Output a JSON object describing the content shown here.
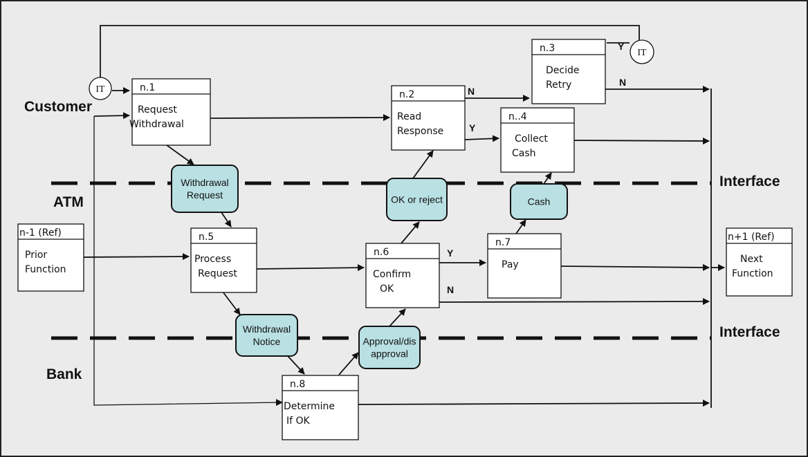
{
  "colors": {
    "background": "#ebebeb",
    "message": "#b9e0e3",
    "line": "#111111",
    "box": "#ffffff"
  },
  "lanes": [
    {
      "id": "customer",
      "label": "Customer"
    },
    {
      "id": "atm",
      "label": "ATM"
    },
    {
      "id": "bank",
      "label": "Bank"
    }
  ],
  "interfaces": [
    {
      "label": "Interface"
    },
    {
      "label": "Interface"
    }
  ],
  "connectors": [
    {
      "label": "IT"
    },
    {
      "label": "IT"
    }
  ],
  "nodes": [
    {
      "id": "n1",
      "ref": "n.1",
      "lines": [
        "Request",
        "Withdrawal"
      ]
    },
    {
      "id": "n2",
      "ref": "n.2",
      "lines": [
        "Read",
        "Response"
      ]
    },
    {
      "id": "n3",
      "ref": "n.3",
      "lines": [
        "Decide",
        "Retry"
      ]
    },
    {
      "id": "n4",
      "ref": "n..4",
      "lines": [
        "Collect",
        "Cash"
      ]
    },
    {
      "id": "n5",
      "ref": "n.5",
      "lines": [
        "Process",
        "Request"
      ]
    },
    {
      "id": "n6",
      "ref": "n.6",
      "lines": [
        "Confirm",
        "OK"
      ]
    },
    {
      "id": "n7",
      "ref": "n.7",
      "lines": [
        "Pay"
      ]
    },
    {
      "id": "n8",
      "ref": "n.8",
      "lines": [
        "Determine",
        "If  OK"
      ]
    },
    {
      "id": "prev",
      "ref": "n-1 (Ref)",
      "lines": [
        "Prior",
        "Function"
      ]
    },
    {
      "id": "next",
      "ref": "n+1 (Ref)",
      "lines": [
        "Next",
        "Function"
      ]
    }
  ],
  "messages": [
    {
      "id": "m1",
      "lines": [
        "Withdrawal",
        "Request"
      ]
    },
    {
      "id": "m2",
      "lines": [
        "OK or reject"
      ]
    },
    {
      "id": "m3",
      "lines": [
        "Cash"
      ]
    },
    {
      "id": "m4",
      "lines": [
        "Withdrawal",
        "Notice"
      ]
    },
    {
      "id": "m5",
      "lines": [
        "Approval/dis",
        "approval"
      ]
    }
  ],
  "decision_labels": [
    {
      "from": "n.2",
      "label": "N"
    },
    {
      "from": "n.2",
      "label": "Y"
    },
    {
      "from": "n.3",
      "label": "Y"
    },
    {
      "from": "n.3",
      "label": "N"
    },
    {
      "from": "n.6",
      "label": "Y"
    },
    {
      "from": "n.6",
      "label": "N"
    }
  ]
}
